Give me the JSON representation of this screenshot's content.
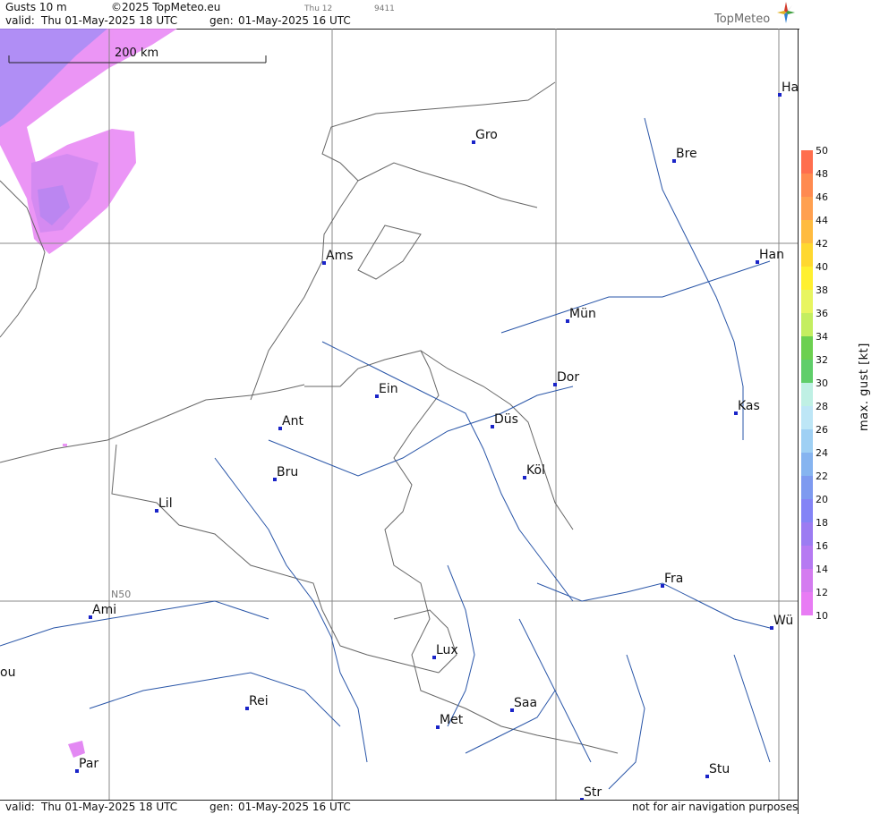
{
  "header": {
    "param": "Gusts 10 m",
    "copyright": "©2025 TopMeteo.eu",
    "run_tag": "Thu 12",
    "run_id": "9411",
    "valid_label": "valid:",
    "valid_time": "Thu  01-May-2025  18 UTC",
    "gen_label": "gen:",
    "gen_time": "01-May-2025 16 UTC",
    "logo_text": "TopMeteo"
  },
  "scale": {
    "label": "200 km"
  },
  "grid": {
    "lat_label": "N50"
  },
  "cities": [
    {
      "name": "Ha"
    },
    {
      "name": "Gro"
    },
    {
      "name": "Bre"
    },
    {
      "name": "Ams"
    },
    {
      "name": "Han"
    },
    {
      "name": "Mün"
    },
    {
      "name": "Dor"
    },
    {
      "name": "Ein"
    },
    {
      "name": "Kas"
    },
    {
      "name": "Ant"
    },
    {
      "name": "Düs"
    },
    {
      "name": "Köl"
    },
    {
      "name": "Bru"
    },
    {
      "name": "Lil"
    },
    {
      "name": "Fra"
    },
    {
      "name": "Ami"
    },
    {
      "name": "Wü"
    },
    {
      "name": "Lux"
    },
    {
      "name": "ou"
    },
    {
      "name": "Rei"
    },
    {
      "name": "Saa"
    },
    {
      "name": "Met"
    },
    {
      "name": "Par"
    },
    {
      "name": "Stu"
    },
    {
      "name": "Str"
    }
  ],
  "legend": {
    "title": "max. gust [kt]",
    "ticks": [
      "50",
      "48",
      "46",
      "44",
      "42",
      "40",
      "38",
      "36",
      "34",
      "32",
      "30",
      "28",
      "26",
      "24",
      "22",
      "20",
      "18",
      "16",
      "14",
      "12",
      "10"
    ],
    "colors": [
      "#ff6e4e",
      "#ff8a50",
      "#ffa050",
      "#ffbb40",
      "#ffd830",
      "#fff030",
      "#e8f560",
      "#c4ee60",
      "#6cd050",
      "#5fce6a",
      "#bff0e4",
      "#bde6f6",
      "#9fd0f4",
      "#86b4f0",
      "#7e9af0",
      "#8484f6",
      "#9c7cf2",
      "#b67af2",
      "#d47cf0",
      "#e87cf4"
    ]
  },
  "footer": {
    "valid_label": "valid:",
    "valid_time": "Thu  01-May-2025  18 UTC",
    "gen_label": "gen:",
    "gen_time": "01-May-2025 16 UTC",
    "disclaimer": "not for air navigation purposes"
  }
}
